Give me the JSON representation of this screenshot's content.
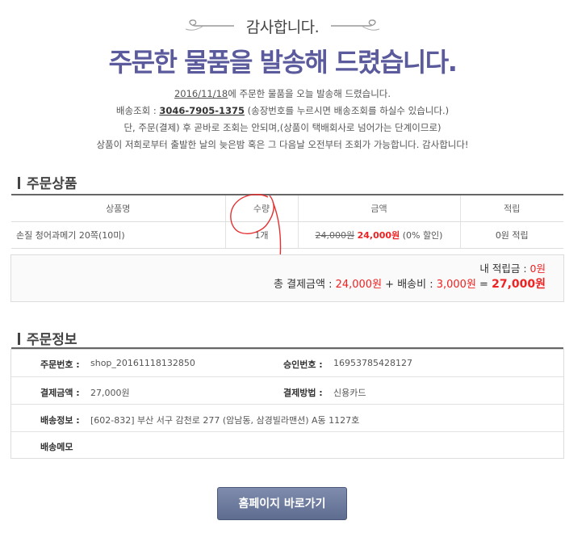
{
  "header": {
    "thanks": "감사합니다.",
    "headline": "주문한 물품을 발송해 드렸습니다."
  },
  "notice": {
    "date": "2016/11/18",
    "line1_suffix": "에 주문한 물품을 오늘 발송해 드렸습니다.",
    "line2_prefix": "배송조회 : ",
    "tracking_number": "3046-7905-1375",
    "line2_suffix": " (송장번호를 누르시면 배송조회를 하실수 있습니다.)",
    "line3": "단, 주문(결제) 후 곧바로 조회는 안되며,(상품이 택배회사로 넘어가는 단계이므로)",
    "line4": "상품이 저희로부터 출발한 날의 늦은밤 혹은 그 다음날 오전부터 조회가 가능합니다. 감사합니다!"
  },
  "order_products": {
    "title": "주문상품",
    "headers": [
      "상품명",
      "수량",
      "금액",
      "적립"
    ],
    "rows": [
      {
        "name": "손질 청어과메기 20쪽(10미)",
        "qty": "1개",
        "original_price": "24,000원",
        "sale_price": "24,000원",
        "discount": "(0% 할인)",
        "points": "0원 적립"
      }
    ]
  },
  "summary": {
    "points_label": "내 적립금 : ",
    "points_value": "0원",
    "total_label": "총 결제금액 : ",
    "total_value": "24,000원",
    "plus": " + 배송비 : ",
    "shipping_value": "3,000원",
    "equals": " = ",
    "grand_total": "27,000원"
  },
  "order_info": {
    "title": "주문정보",
    "order_no_label": "주문번호 :",
    "order_no": "shop_20161118132850",
    "approval_label": "승인번호 :",
    "approval_no": "16953785428127",
    "payment_amount_label": "결제금액 :",
    "payment_amount": "27,000원",
    "payment_method_label": "결제방법 :",
    "payment_method": "신용카드",
    "shipping_info_label": "배송정보 :",
    "shipping_info": "[602-832] 부산 서구 감천로 277 (암남동, 삼경빌라맨션) A동 1127호",
    "memo_label": "배송메모"
  },
  "buttons": {
    "home": "홈페이지 바로가기"
  },
  "colors": {
    "headline": "#5a5a9c",
    "sale": "#ee2222",
    "button": "#6b7898"
  }
}
